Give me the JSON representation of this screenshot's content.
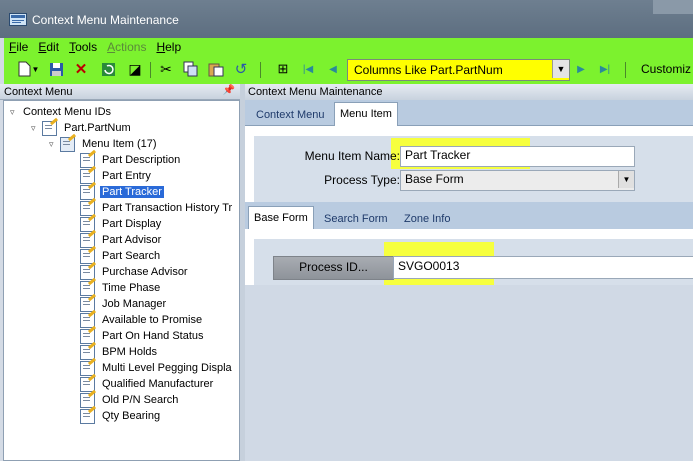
{
  "window": {
    "title": "Context Menu Maintenance"
  },
  "menubar": {
    "items": [
      {
        "label": "File",
        "accel": "F",
        "rest": "ile",
        "enabled": true
      },
      {
        "label": "Edit",
        "accel": "E",
        "rest": "dit",
        "enabled": true
      },
      {
        "label": "Tools",
        "accel": "T",
        "rest": "ools",
        "enabled": true
      },
      {
        "label": "Actions",
        "accel": "A",
        "rest": "ctions",
        "enabled": false
      },
      {
        "label": "Help",
        "accel": "H",
        "rest": "elp",
        "enabled": true
      }
    ]
  },
  "toolbar": {
    "search_combo_value": "Columns Like Part.PartNum",
    "customize_label": "Customiz",
    "icons": [
      "new-icon",
      "dropdown-arrow-icon",
      "save-icon",
      "delete-icon",
      "refresh-icon",
      "clear-icon",
      "cut-icon",
      "copy-icon",
      "paste-icon",
      "undo-icon",
      "binoculars-icon",
      "first-record-icon",
      "previous-record-icon",
      "next-record-icon",
      "last-record-icon"
    ]
  },
  "left_panel": {
    "header": "Context Menu",
    "pin_glyph": "📌",
    "tree": {
      "root": "Context Menu IDs",
      "level1": "Part.PartNum",
      "level2": "Menu Item (17)",
      "items": [
        "Part Description",
        "Part Entry",
        "Part Tracker",
        "Part Transaction History Tr",
        "Part Display",
        "Part Advisor",
        "Part Search",
        "Purchase Advisor",
        "Time Phase",
        "Job Manager",
        "Available to Promise",
        "Part On Hand Status",
        "BPM Holds",
        "Multi Level Pegging Displa",
        "Qualified Manufacturer",
        "Old P/N Search",
        "Qty Bearing"
      ],
      "selected_item": "Part Tracker"
    }
  },
  "right_panel": {
    "header": "Context Menu Maintenance",
    "tabs": [
      "Context Menu",
      "Menu Item"
    ],
    "active_tab": "Menu Item",
    "menu_item_name_label": "Menu Item Name:",
    "menu_item_name_value": "Part Tracker",
    "process_type_label": "Process Type:",
    "process_type_value": "Base Form",
    "subtabs": [
      "Base Form",
      "Search Form",
      "Zone Info"
    ],
    "active_subtab": "Base Form",
    "process_id_button": "Process ID...",
    "process_id_value": "SVGO0013"
  },
  "colors": {
    "highlight_green": "#7cf22e",
    "highlight_yellow": "#f6ff3e",
    "selection_blue": "#2a6ad8"
  }
}
